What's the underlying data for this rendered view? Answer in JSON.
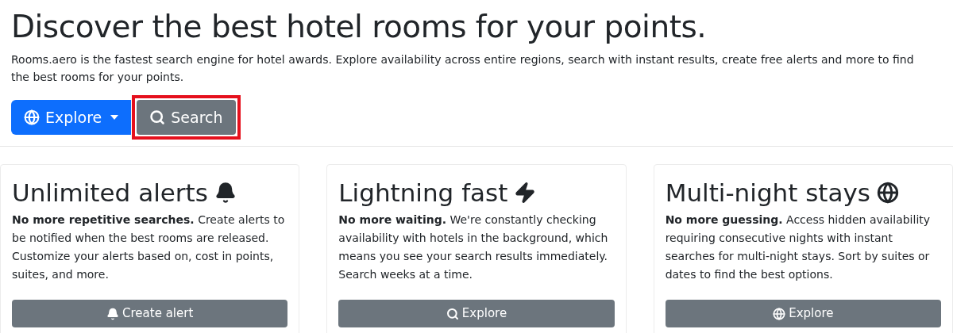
{
  "hero": {
    "title": "Discover the best hotel rooms for your points.",
    "description": "Rooms.aero is the fastest search engine for hotel awards. Explore availability across entire regions, search with instant results, create free alerts and more to find the best rooms for your points.",
    "buttons": [
      {
        "label": "Explore",
        "kind": "dropdown",
        "highlighted": false
      },
      {
        "label": "Search",
        "kind": "plain",
        "highlighted": true
      }
    ]
  },
  "features": [
    {
      "title": "Unlimited alerts",
      "text": "**No more repetitive searches.** Create alerts to be notified when the best rooms are released. Customize your alerts based on, cost in points, suites, and more.",
      "button": "Create alert"
    },
    {
      "title": "Lightning fast",
      "text": "**No more waiting.** We're constantly checking availability with hotels in the background, which means you see your search results immediately. Search weeks at a time.",
      "button": "Explore"
    },
    {
      "title": "Multi-night stays",
      "text": "**No more guessing.** Access hidden availability requiring consecutive nights with instant searches for multi-night stays. Sort by suites or dates to find the best options.",
      "button": "Explore"
    }
  ]
}
